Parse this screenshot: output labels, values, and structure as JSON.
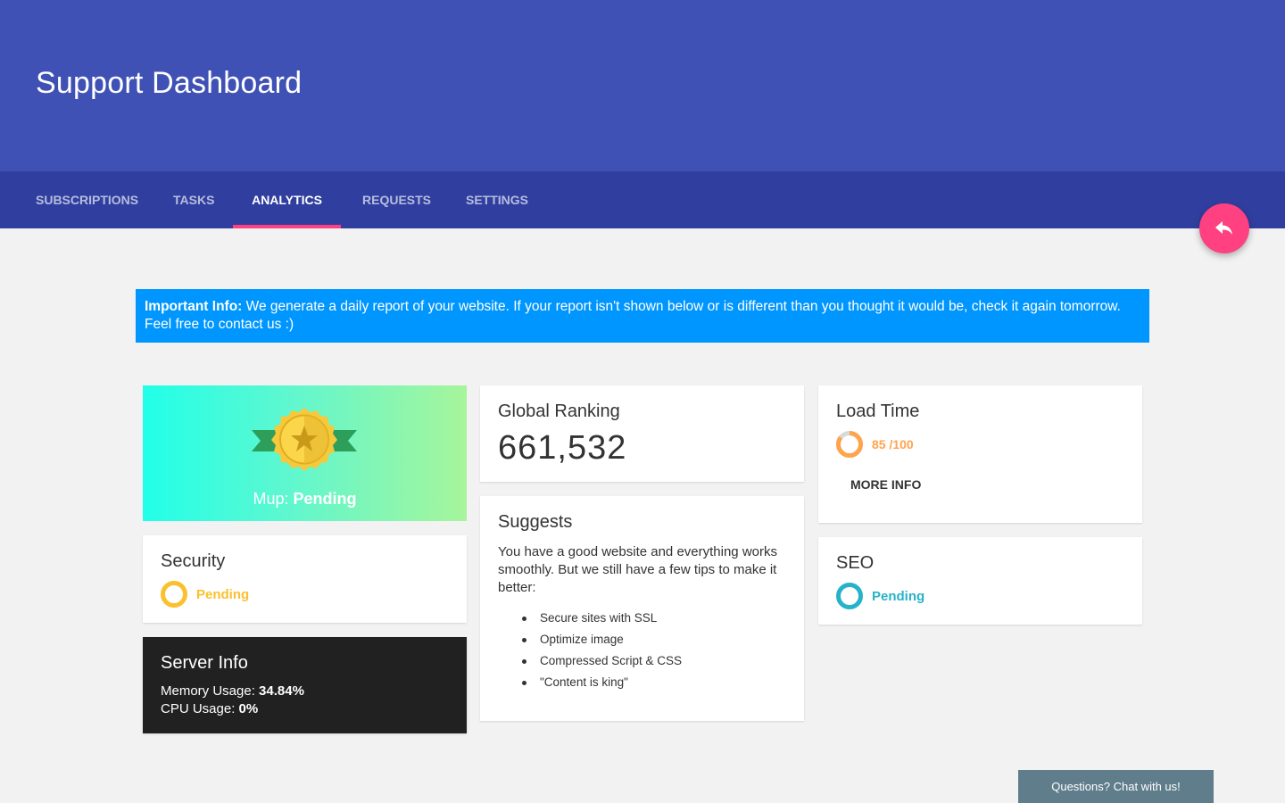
{
  "header": {
    "title": "Support Dashboard",
    "background": "#3f51b5"
  },
  "tabs": [
    {
      "label": "SUBSCRIPTIONS",
      "active": false
    },
    {
      "label": "TASKS",
      "active": false
    },
    {
      "label": "ANALYTICS",
      "active": true
    },
    {
      "label": "REQUESTS",
      "active": false
    },
    {
      "label": "SETTINGS",
      "active": false
    }
  ],
  "fab": {
    "icon": "reply-icon",
    "color": "#ff4081"
  },
  "banner": {
    "label": "Important Info:",
    "text": " We generate a daily report of your website. If your report isn't shown below or is different than you thought it would be, check it again tomorrow. Feel free to contact us :)",
    "color": "#0096ff"
  },
  "mup": {
    "label": "Mup: ",
    "status": "Pending",
    "icon": "medal-icon"
  },
  "security": {
    "title": "Security",
    "status": "Pending",
    "color": "#fbc02d"
  },
  "server": {
    "title": "Server Info",
    "memory_label": "Memory Usage: ",
    "memory_value": "34.84%",
    "cpu_label": "CPU Usage: ",
    "cpu_value": "0%"
  },
  "ranking": {
    "title": "Global Ranking",
    "value": "661,532"
  },
  "suggests": {
    "title": "Suggests",
    "text": "You have a good website and everything works smoothly. But we still have a few tips to make it better:",
    "tips": [
      "Secure sites with SSL",
      "Optimize image",
      "Compressed Script & CSS",
      "\"Content is king\""
    ]
  },
  "load_time": {
    "title": "Load Time",
    "score": "85 /100",
    "score_fraction": 0.85,
    "color": "#ffa34d",
    "more_label": "MORE INFO"
  },
  "seo": {
    "title": "SEO",
    "status": "Pending",
    "color": "#26b3c9"
  },
  "chat": {
    "label": "Questions? Chat with us!",
    "color": "#607d8b"
  }
}
